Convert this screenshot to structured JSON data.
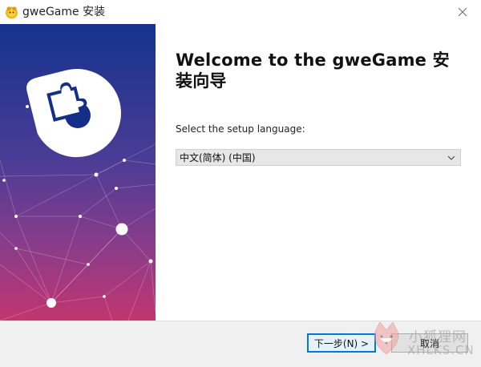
{
  "window": {
    "title": "gweGame 安装",
    "close_icon": "close-icon",
    "app_icon": "gwegame-app-icon"
  },
  "content": {
    "heading": "Welcome to the gweGame 安装向导",
    "language_label": "Select the setup language:",
    "language_select": {
      "selected": "中文(简体) (中国)",
      "arrow_icon": "chevron-down-icon"
    }
  },
  "footer": {
    "next_label": "下一步(N) >",
    "cancel_label": "取消"
  },
  "watermark": {
    "cn": "小狐狸网",
    "en": "XHLKS.CN"
  },
  "colors": {
    "banner_top": "#13358e",
    "banner_bottom": "#c2356f",
    "focus_border": "#0078d7",
    "footer_bg": "#f0f0f0"
  }
}
